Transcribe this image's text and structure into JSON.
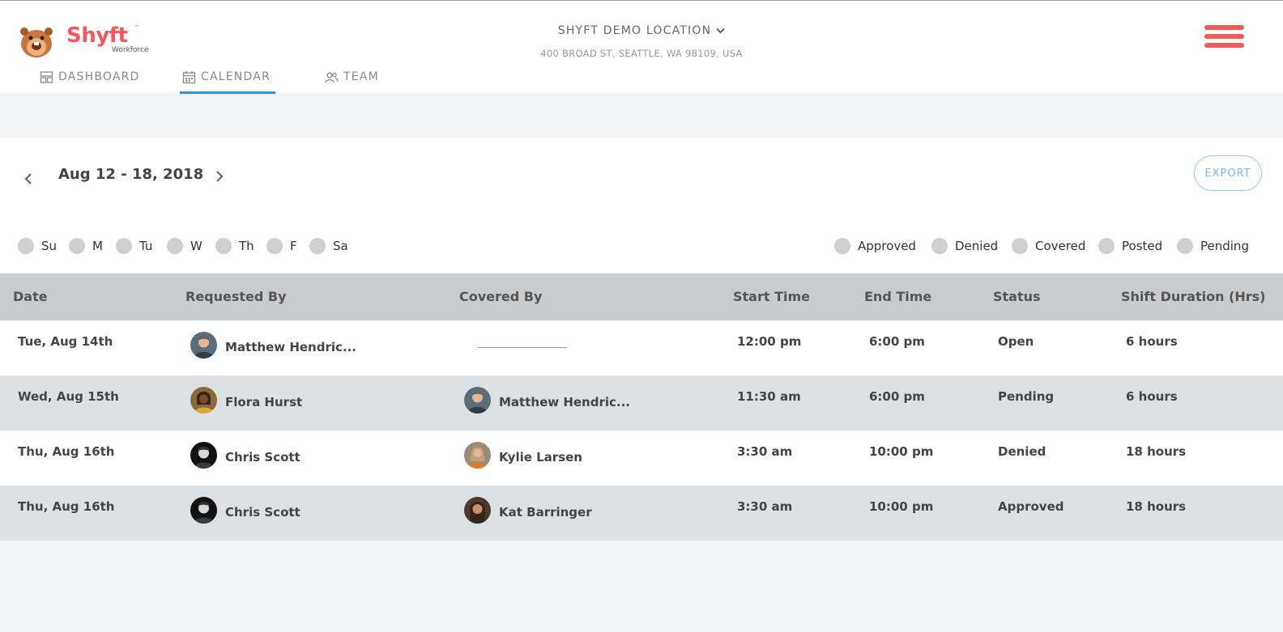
{
  "brand": {
    "name": "Shyft",
    "tm": "™",
    "sub": "Workforce",
    "color": "#f15a5a"
  },
  "location": {
    "name": "SHYFT DEMO LOCATION",
    "address": "400 BROAD ST, SEATTLE, WA 98109, USA"
  },
  "nav": {
    "tabs": [
      {
        "label": "DASHBOARD",
        "icon": "dashboard-icon"
      },
      {
        "label": "CALENDAR",
        "icon": "calendar-icon",
        "active": true
      },
      {
        "label": "TEAM",
        "icon": "team-icon"
      }
    ]
  },
  "toolbar": {
    "week_label": "Aug 12 - 18, 2018",
    "export_label": "EXPORT"
  },
  "day_filters": [
    "Su",
    "M",
    "Tu",
    "W",
    "Th",
    "F",
    "Sa"
  ],
  "status_filters": [
    "Approved",
    "Denied",
    "Covered",
    "Posted",
    "Pending"
  ],
  "table": {
    "headers": [
      "Date",
      "Requested By",
      "Covered By",
      "Start Time",
      "End Time",
      "Status",
      "Shift Duration (Hrs)"
    ],
    "rows": [
      {
        "date": "Tue, Aug 14th",
        "requested_by": "Matthew Hendric...",
        "covered_by": "",
        "start": "12:00 pm",
        "end": "6:00 pm",
        "status": "Open",
        "duration": "6 hours"
      },
      {
        "date": "Wed, Aug 15th",
        "requested_by": "Flora Hurst",
        "covered_by": "Matthew Hendric...",
        "start": "11:30 am",
        "end": "6:00 pm",
        "status": "Pending",
        "duration": "6 hours"
      },
      {
        "date": "Thu, Aug 16th",
        "requested_by": "Chris Scott",
        "covered_by": "Kylie Larsen",
        "start": "3:30 am",
        "end": "10:00 pm",
        "status": "Denied",
        "duration": "18 hours"
      },
      {
        "date": "Thu, Aug 16th",
        "requested_by": "Chris Scott",
        "covered_by": "Kat Barringer",
        "start": "3:30 am",
        "end": "10:00 pm",
        "status": "Approved",
        "duration": "18 hours"
      }
    ]
  },
  "colors": {
    "accent": "#2b9be6",
    "header_row": "#cacbcd",
    "alt_row": "#dde1e4",
    "filter_dot": "#cfcfcf"
  }
}
